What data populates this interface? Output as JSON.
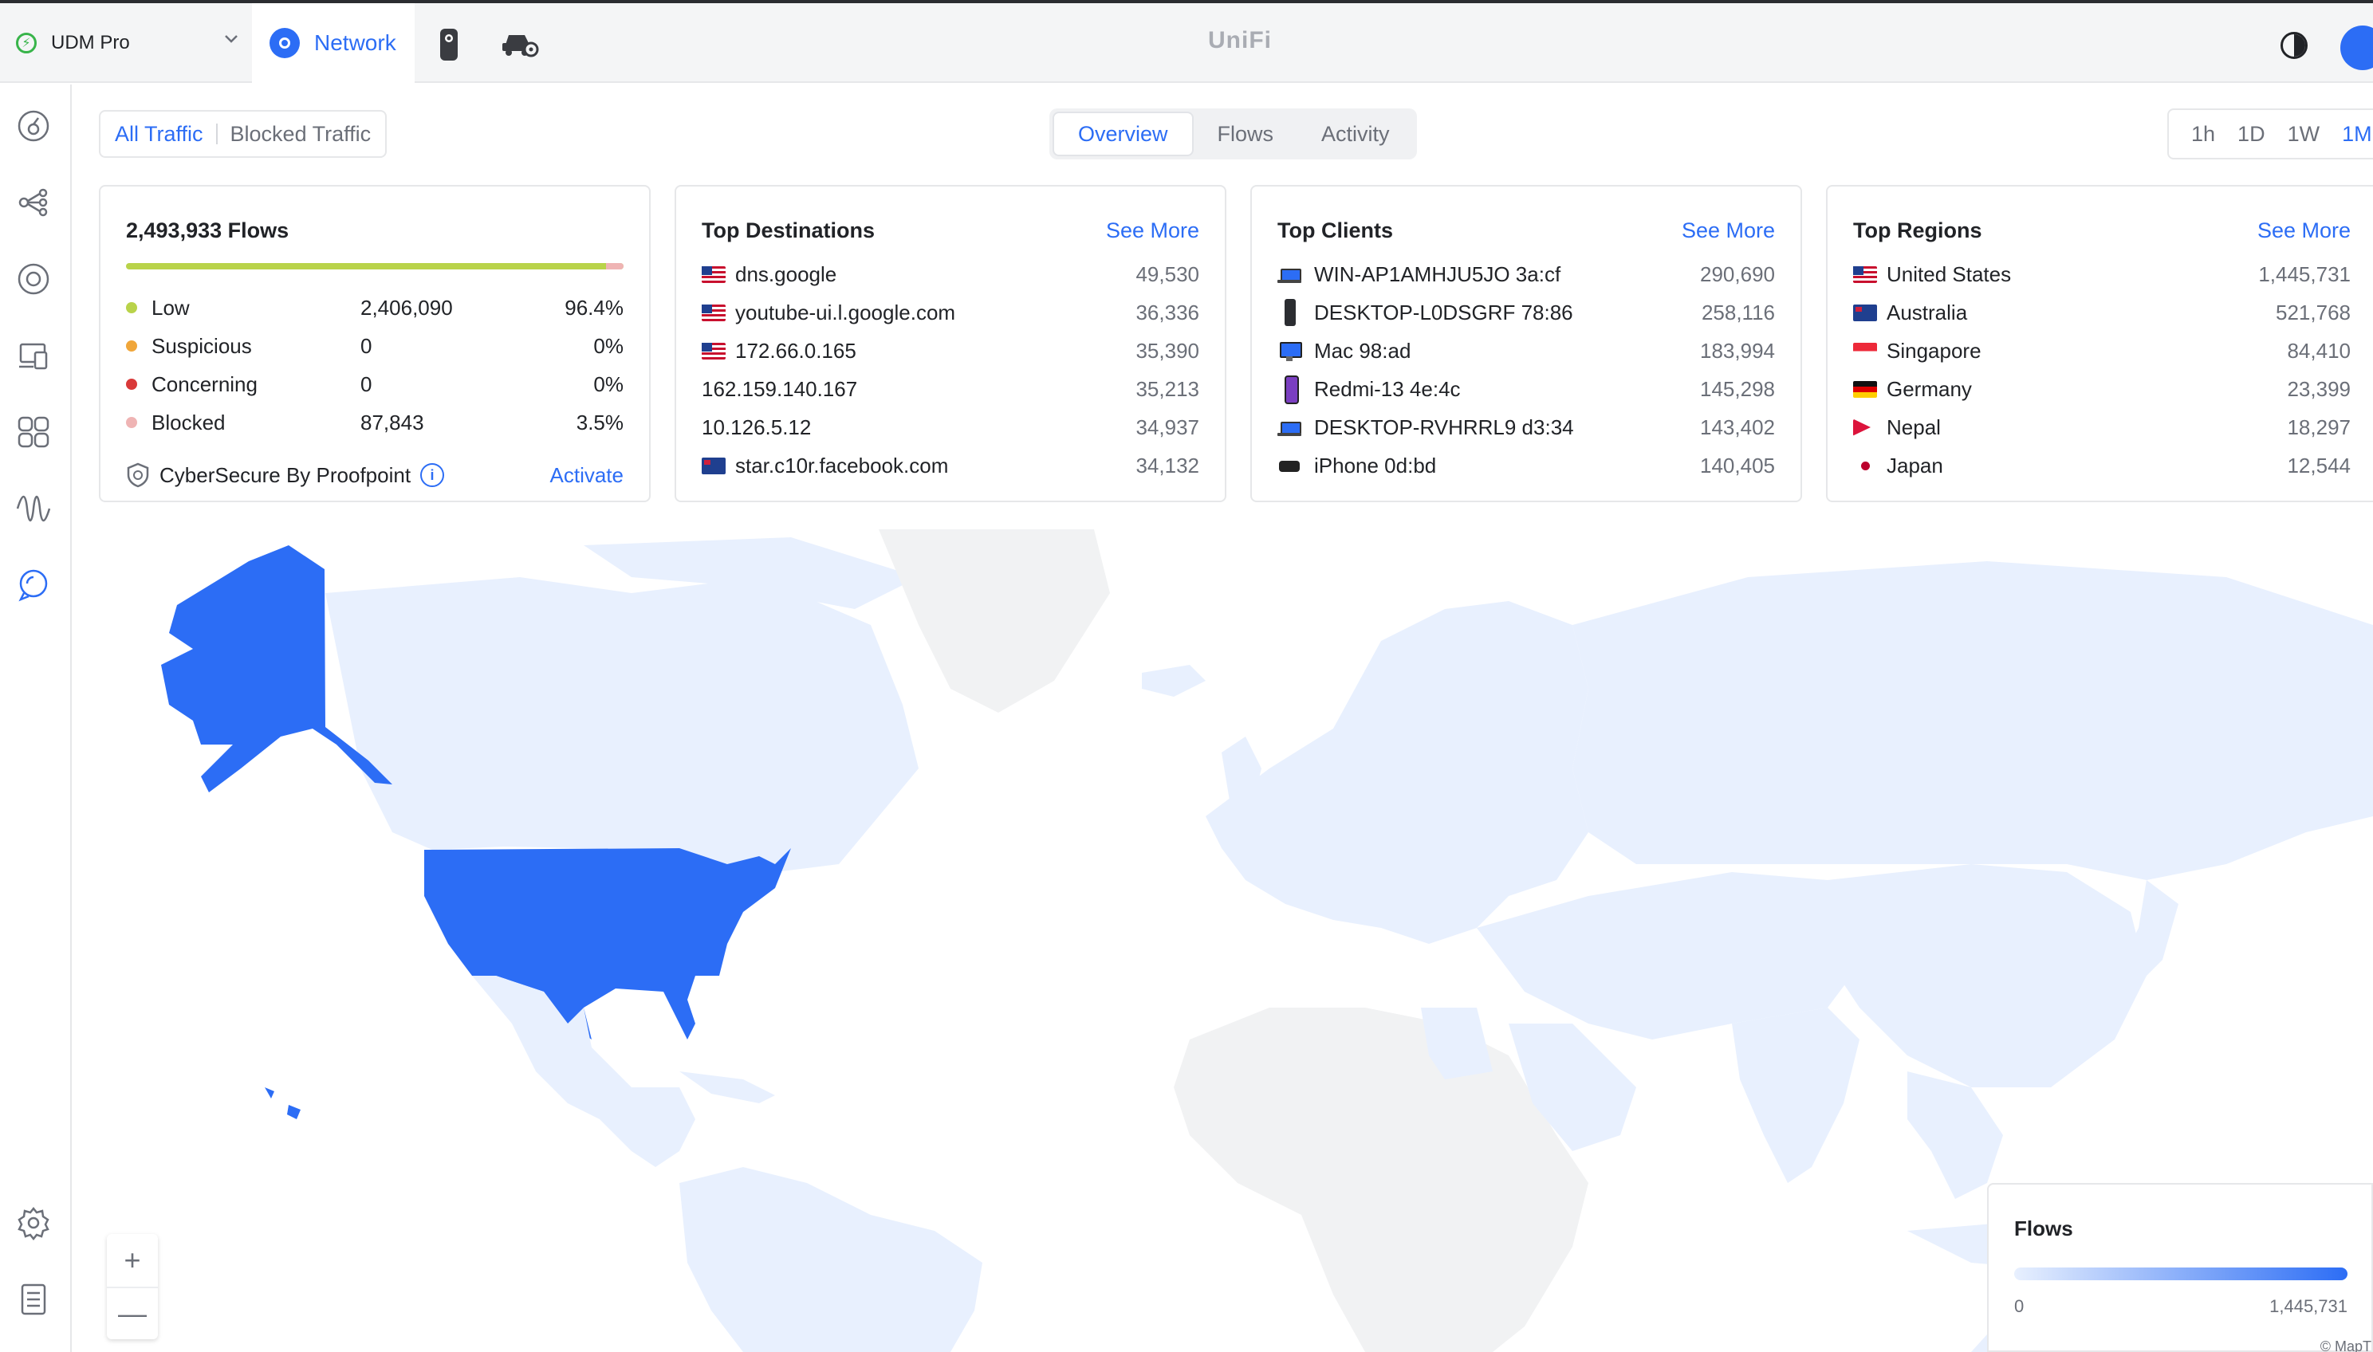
{
  "header": {
    "device_name": "UDM Pro",
    "active_app": "Network",
    "brand": "UniFi"
  },
  "controls": {
    "traffic_filter": {
      "all": "All Traffic",
      "blocked": "Blocked Traffic"
    },
    "views": [
      "Overview",
      "Flows",
      "Activity"
    ],
    "active_view": "Overview",
    "ranges": [
      "1h",
      "1D",
      "1W",
      "1M"
    ],
    "active_range": "1M"
  },
  "flows_card": {
    "title": "2,493,933 Flows",
    "low_share": 0.964,
    "rows": [
      {
        "label": "Low",
        "count": "2,406,090",
        "percent": "96.4%",
        "color": "#b9d34a"
      },
      {
        "label": "Suspicious",
        "count": "0",
        "percent": "0%",
        "color": "#f0a63a"
      },
      {
        "label": "Concerning",
        "count": "0",
        "percent": "0%",
        "color": "#d93a3a"
      },
      {
        "label": "Blocked",
        "count": "87,843",
        "percent": "3.5%",
        "color": "#efb4b4"
      }
    ],
    "cybersecure": "CyberSecure By Proofpoint",
    "activate": "Activate"
  },
  "top_destinations": {
    "title": "Top Destinations",
    "see_more": "See More",
    "items": [
      {
        "flag": "us",
        "name": "dns.google",
        "value": "49,530"
      },
      {
        "flag": "us",
        "name": "youtube-ui.l.google.com",
        "value": "36,336"
      },
      {
        "flag": "us",
        "name": "172.66.0.165",
        "value": "35,390"
      },
      {
        "flag": "none",
        "name": "162.159.140.167",
        "value": "35,213"
      },
      {
        "flag": "none",
        "name": "10.126.5.12",
        "value": "34,937"
      },
      {
        "flag": "au",
        "name": "star.c10r.facebook.com",
        "value": "34,132"
      }
    ]
  },
  "top_clients": {
    "title": "Top Clients",
    "see_more": "See More",
    "items": [
      {
        "icon": "laptop",
        "name": "WIN-AP1AMHJU5JO 3a:cf",
        "value": "290,690"
      },
      {
        "icon": "tower",
        "name": "DESKTOP-L0DSGRF 78:86",
        "value": "258,116"
      },
      {
        "icon": "mac",
        "name": "Mac 98:ad",
        "value": "183,994"
      },
      {
        "icon": "phone",
        "name": "Redmi-13 4e:4c",
        "value": "145,298"
      },
      {
        "icon": "laptop",
        "name": "DESKTOP-RVHRRL9 d3:34",
        "value": "143,402"
      },
      {
        "icon": "iphone",
        "name": "iPhone 0d:bd",
        "value": "140,405"
      }
    ]
  },
  "top_regions": {
    "title": "Top Regions",
    "see_more": "See More",
    "items": [
      {
        "flag": "us",
        "name": "United States",
        "value": "1,445,731"
      },
      {
        "flag": "au",
        "name": "Australia",
        "value": "521,768"
      },
      {
        "flag": "sg",
        "name": "Singapore",
        "value": "84,410"
      },
      {
        "flag": "de",
        "name": "Germany",
        "value": "23,399"
      },
      {
        "flag": "np",
        "name": "Nepal",
        "value": "18,297"
      },
      {
        "flag": "jp",
        "name": "Japan",
        "value": "12,544"
      }
    ]
  },
  "map": {
    "legend_title": "Flows",
    "legend_min": "0",
    "legend_max": "1,445,731",
    "credit": "© MapT",
    "zoom_in": "+",
    "zoom_out": "—",
    "colors": {
      "max": "#2c6df5",
      "low": "#e8f0fe",
      "none": "#f1f2f3"
    }
  },
  "sidebar": {
    "icons": [
      "dashboard-icon",
      "topology-icon",
      "devices-icon",
      "clients-icon",
      "apps-icon",
      "insights-icon",
      "flows-icon",
      "settings-icon",
      "logs-icon"
    ]
  }
}
